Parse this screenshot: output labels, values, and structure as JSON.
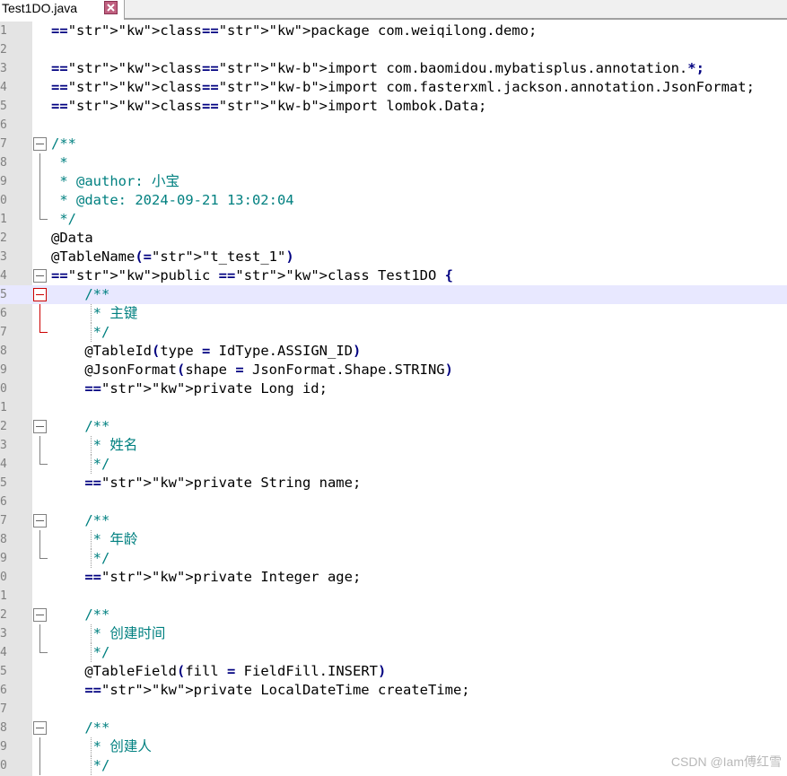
{
  "tab": {
    "filename": "Test1DO.java",
    "close_icon": "close-icon"
  },
  "lines": [
    {
      "n": "1",
      "t": "package com.weiqilong.demo;"
    },
    {
      "n": "2",
      "t": ""
    },
    {
      "n": "3",
      "t": "import com.baomidou.mybatisplus.annotation.*;"
    },
    {
      "n": "4",
      "t": "import com.fasterxml.jackson.annotation.JsonFormat;"
    },
    {
      "n": "5",
      "t": "import lombok.Data;"
    },
    {
      "n": "6",
      "t": ""
    },
    {
      "n": "7",
      "t": "/**"
    },
    {
      "n": "8",
      "t": " *"
    },
    {
      "n": "9",
      "t": " * @author: 小宝"
    },
    {
      "n": "0",
      "t": " * @date: 2024-09-21 13:02:04"
    },
    {
      "n": "1",
      "t": " */"
    },
    {
      "n": "2",
      "t": "@Data"
    },
    {
      "n": "3",
      "t": "@TableName(\"t_test_1\")"
    },
    {
      "n": "4",
      "t": "public class Test1DO {"
    },
    {
      "n": "5",
      "t": "    /**"
    },
    {
      "n": "6",
      "t": "     * 主键"
    },
    {
      "n": "7",
      "t": "     */"
    },
    {
      "n": "8",
      "t": "    @TableId(type = IdType.ASSIGN_ID)"
    },
    {
      "n": "9",
      "t": "    @JsonFormat(shape = JsonFormat.Shape.STRING)"
    },
    {
      "n": "0",
      "t": "    private Long id;"
    },
    {
      "n": "1",
      "t": ""
    },
    {
      "n": "2",
      "t": "    /**"
    },
    {
      "n": "3",
      "t": "     * 姓名"
    },
    {
      "n": "4",
      "t": "     */"
    },
    {
      "n": "5",
      "t": "    private String name;"
    },
    {
      "n": "6",
      "t": ""
    },
    {
      "n": "7",
      "t": "    /**"
    },
    {
      "n": "8",
      "t": "     * 年龄"
    },
    {
      "n": "9",
      "t": "     */"
    },
    {
      "n": "0",
      "t": "    private Integer age;"
    },
    {
      "n": "1",
      "t": ""
    },
    {
      "n": "2",
      "t": "    /**"
    },
    {
      "n": "3",
      "t": "     * 创建时间"
    },
    {
      "n": "4",
      "t": "     */"
    },
    {
      "n": "5",
      "t": "    @TableField(fill = FieldFill.INSERT)"
    },
    {
      "n": "6",
      "t": "    private LocalDateTime createTime;"
    },
    {
      "n": "7",
      "t": ""
    },
    {
      "n": "8",
      "t": "    /**"
    },
    {
      "n": "9",
      "t": "     * 创建人"
    },
    {
      "n": "0",
      "t": "     */"
    }
  ],
  "watermark": "CSDN @Iam傅红雪",
  "colors": {
    "keyword_bold": "#0000ff",
    "keyword": "#7f0055",
    "comment": "#008080",
    "current_line": "#e8e8ff"
  }
}
